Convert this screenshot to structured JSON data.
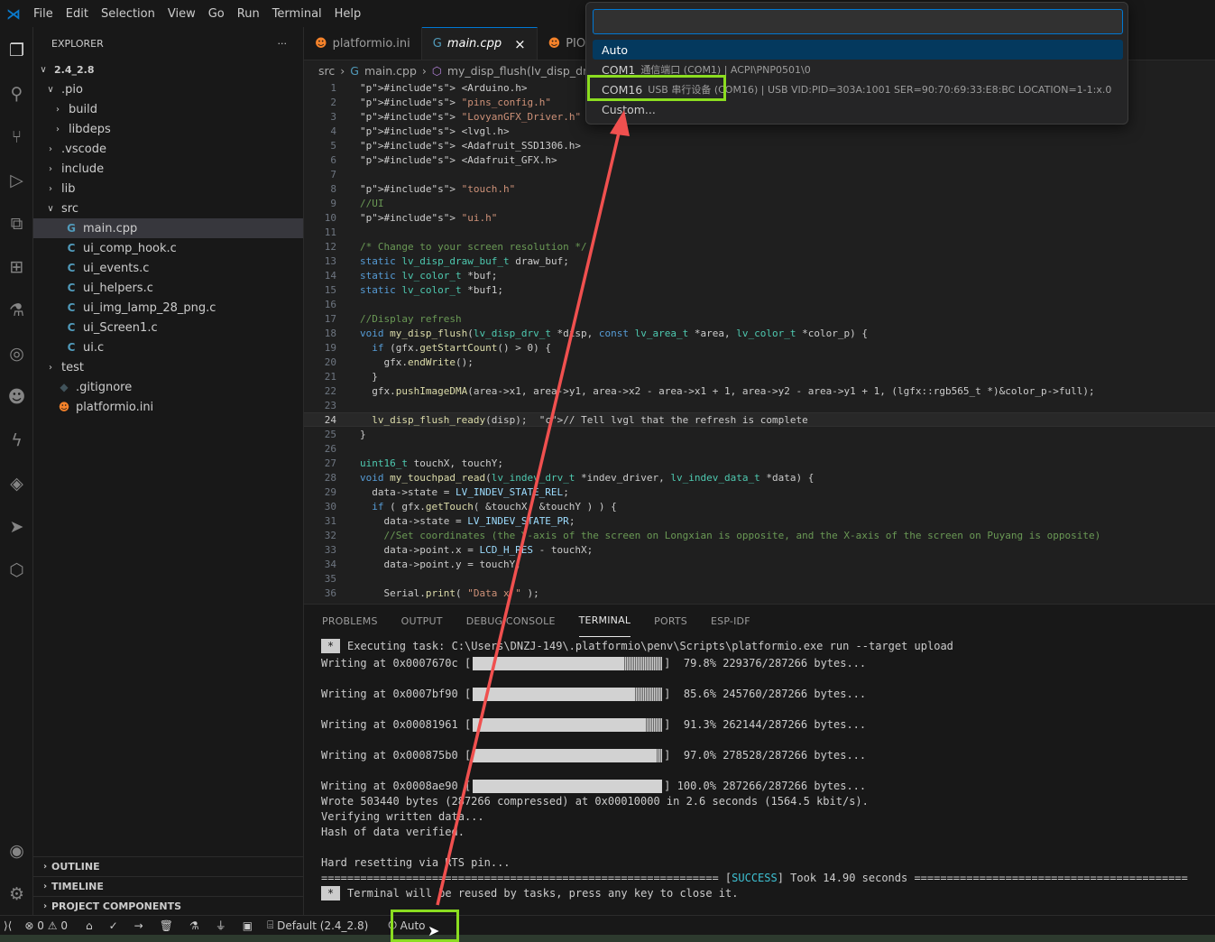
{
  "menubar": {
    "items": [
      "File",
      "Edit",
      "Selection",
      "View",
      "Go",
      "Run",
      "Terminal",
      "Help"
    ]
  },
  "activity_icons": [
    "files-icon",
    "search-icon",
    "source-control-icon",
    "run-debug-icon",
    "remote-explorer-icon",
    "extensions-icon",
    "testing-icon",
    "platformio-icon",
    "alien-icon",
    "lightning-icon",
    "python-icon",
    "send-icon",
    "hexagon-icon",
    "account-icon",
    "settings-gear-icon"
  ],
  "sidebar": {
    "title": "EXPLORER",
    "more": "···",
    "tree": [
      {
        "label": "2.4_2.8",
        "depth": 0,
        "type": "folder-open",
        "bold": true
      },
      {
        "label": ".pio",
        "depth": 1,
        "type": "folder-open"
      },
      {
        "label": "build",
        "depth": 2,
        "type": "folder"
      },
      {
        "label": "libdeps",
        "depth": 2,
        "type": "folder"
      },
      {
        "label": ".vscode",
        "depth": 1,
        "type": "folder"
      },
      {
        "label": "include",
        "depth": 1,
        "type": "folder"
      },
      {
        "label": "lib",
        "depth": 1,
        "type": "folder"
      },
      {
        "label": "src",
        "depth": 1,
        "type": "folder-open"
      },
      {
        "label": "main.cpp",
        "depth": 2,
        "type": "cpp",
        "selected": true
      },
      {
        "label": "ui_comp_hook.c",
        "depth": 2,
        "type": "c"
      },
      {
        "label": "ui_events.c",
        "depth": 2,
        "type": "c"
      },
      {
        "label": "ui_helpers.c",
        "depth": 2,
        "type": "c"
      },
      {
        "label": "ui_img_lamp_28_png.c",
        "depth": 2,
        "type": "c"
      },
      {
        "label": "ui_Screen1.c",
        "depth": 2,
        "type": "c"
      },
      {
        "label": "ui.c",
        "depth": 2,
        "type": "c"
      },
      {
        "label": "test",
        "depth": 1,
        "type": "folder"
      },
      {
        "label": ".gitignore",
        "depth": 1,
        "type": "gitignore"
      },
      {
        "label": "platformio.ini",
        "depth": 1,
        "type": "pio"
      }
    ],
    "sections": [
      "OUTLINE",
      "TIMELINE",
      "PROJECT COMPONENTS"
    ]
  },
  "tabs": [
    {
      "label": "platformio.ini",
      "icon": "pio",
      "active": false
    },
    {
      "label": "main.cpp",
      "icon": "cpp",
      "active": true,
      "close": "×"
    },
    {
      "label": "PIO",
      "icon": "pio",
      "active": false
    }
  ],
  "breadcrumb": {
    "root": "src",
    "sep": "›",
    "file": "main.cpp",
    "symbol": "my_disp_flush(lv_disp_drv_t"
  },
  "editor": {
    "current_line": 24,
    "lines": [
      "#include <Arduino.h>",
      "#include \"pins_config.h\"",
      "#include \"LovyanGFX_Driver.h\"",
      "#include <lvgl.h>",
      "#include <Adafruit_SSD1306.h>",
      "#include <Adafruit_GFX.h>",
      "",
      "#include \"touch.h\"",
      "//UI",
      "#include \"ui.h\"",
      "",
      "/* Change to your screen resolution */",
      "static lv_disp_draw_buf_t draw_buf;",
      "static lv_color_t *buf;",
      "static lv_color_t *buf1;",
      "",
      "//Display refresh",
      "void my_disp_flush(lv_disp_drv_t *disp, const lv_area_t *area, lv_color_t *color_p) {",
      "  if (gfx.getStartCount() > 0) {",
      "    gfx.endWrite();",
      "  }",
      "  gfx.pushImageDMA(area->x1, area->y1, area->x2 - area->x1 + 1, area->y2 - area->y1 + 1, (lgfx::rgb565_t *)&color_p->full);",
      "",
      "  lv_disp_flush_ready(disp);  // Tell lvgl that the refresh is complete",
      "}",
      "",
      "uint16_t touchX, touchY;",
      "void my_touchpad_read(lv_indev_drv_t *indev_driver, lv_indev_data_t *data) {",
      "  data->state = LV_INDEV_STATE_REL;",
      "  if ( gfx.getTouch( &touchX, &touchY ) ) {",
      "    data->state = LV_INDEV_STATE_PR;",
      "    //Set coordinates (the Y-axis of the screen on Longxian is opposite, and the X-axis of the screen on Puyang is opposite)",
      "    data->point.x = LCD_H_RES - touchX;",
      "    data->point.y = touchY;",
      "",
      "    Serial.print( \"Data x \" );"
    ]
  },
  "panel": {
    "tabs": [
      "PROBLEMS",
      "OUTPUT",
      "DEBUG CONSOLE",
      "TERMINAL",
      "PORTS",
      "ESP-IDF"
    ],
    "active": "TERMINAL",
    "star": "*",
    "executing": "Executing task: C:\\Users\\DNZJ-149\\.platformio\\penv\\Scripts\\platformio.exe run --target upload",
    "writes": [
      {
        "addr": "Writing at 0x0007670c [",
        "pct": 79.8,
        "tail": "]  79.8% 229376/287266 bytes..."
      },
      {
        "addr": "Writing at 0x0007bf90 [",
        "pct": 85.6,
        "tail": "]  85.6% 245760/287266 bytes..."
      },
      {
        "addr": "Writing at 0x00081961 [",
        "pct": 91.3,
        "tail": "]  91.3% 262144/287266 bytes..."
      },
      {
        "addr": "Writing at 0x000875b0 [",
        "pct": 97.0,
        "tail": "]  97.0% 278528/287266 bytes..."
      },
      {
        "addr": "Writing at 0x0008ae90 [",
        "pct": 100.0,
        "tail": "] 100.0% 287266/287266 bytes..."
      }
    ],
    "wrote": "Wrote 503440 bytes (287266 compressed) at 0x00010000 in 2.6 seconds (1564.5 kbit/s).",
    "verifying": "Verifying written data...",
    "hash": "Hash of data verified.",
    "reset": "Hard resetting via RTS pin...",
    "success_pre": "============================================================= [",
    "success_word": "SUCCESS",
    "success_post": "] Took 14.90 seconds ==========================================",
    "reuse": "Terminal will be reused by tasks, press any key to close it."
  },
  "statusbar": {
    "remote": "⟩⟨",
    "errors": "0",
    "warnings": "0",
    "env": "Default (2.4_2.8)",
    "port": "Auto"
  },
  "quickpick": {
    "input_value": "",
    "items": [
      {
        "label": "Auto",
        "desc": "",
        "selected": true
      },
      {
        "label": "COM1",
        "desc": "通信端口 (COM1) | ACPI\\PNP0501\\0",
        "selected": false
      },
      {
        "label": "COM16",
        "desc": "USB 串行设备 (COM16) | USB VID:PID=303A:1001 SER=90:70:69:33:E8:BC LOCATION=1-1:x.0",
        "selected": false
      },
      {
        "label": "Custom...",
        "desc": "",
        "selected": false
      }
    ]
  },
  "colors": {
    "accent": "#0078d4",
    "highlight": "#8bdd20",
    "arrow": "#f0504f",
    "success": "#3ec1d3"
  }
}
